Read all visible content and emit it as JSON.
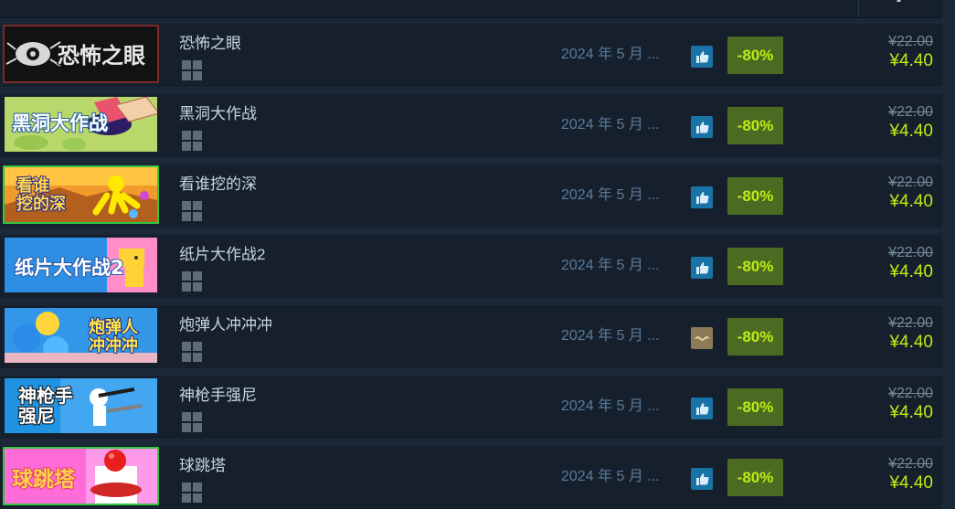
{
  "games": [
    {
      "title": "恐怖之眼",
      "date": "2024 年 5 月 ...",
      "review": "positive",
      "discount": "-80%",
      "original_price": "¥22.00",
      "final_price": "¥4.40",
      "capsule_text": "恐怖之眼",
      "capsule_style": "eyes"
    },
    {
      "title": "黑洞大作战",
      "date": "2024 年 5 月 ...",
      "review": "positive",
      "discount": "-80%",
      "original_price": "¥22.00",
      "final_price": "¥4.40",
      "capsule_text": "黑洞大作战",
      "capsule_style": "hole"
    },
    {
      "title": "看谁挖的深",
      "date": "2024 年 5 月 ...",
      "review": "positive",
      "discount": "-80%",
      "original_price": "¥22.00",
      "final_price": "¥4.40",
      "capsule_text": "看谁\n挖的深",
      "capsule_style": "dig"
    },
    {
      "title": "纸片大作战2",
      "date": "2024 年 5 月 ...",
      "review": "positive",
      "discount": "-80%",
      "original_price": "¥22.00",
      "final_price": "¥4.40",
      "capsule_text": "纸片大作战2",
      "capsule_style": "paper"
    },
    {
      "title": "炮弹人冲冲冲",
      "date": "2024 年 5 月 ...",
      "review": "mixed",
      "discount": "-80%",
      "original_price": "¥22.00",
      "final_price": "¥4.40",
      "capsule_text": "炮弹人\n冲冲冲",
      "capsule_style": "cannon"
    },
    {
      "title": "神枪手强尼",
      "date": "2024 年 5 月 ...",
      "review": "positive",
      "discount": "-80%",
      "original_price": "¥22.00",
      "final_price": "¥4.40",
      "capsule_text": "神枪手\n强尼",
      "capsule_style": "gun"
    },
    {
      "title": "球跳塔",
      "date": "2024 年 5 月 ...",
      "review": "positive",
      "discount": "-80%",
      "original_price": "¥22.00",
      "final_price": "¥4.40",
      "capsule_text": "球跳塔",
      "capsule_style": "tower"
    }
  ],
  "colors": {
    "background": "#1b2838",
    "row_background": "#16202d",
    "title": "#c7d5e0",
    "date": "#5b7a99",
    "discount_bg": "#4c6b22",
    "discount_text": "#beee11",
    "price_original": "#738895",
    "price_final": "#beee11",
    "review_positive": "#1a73a6",
    "review_mixed": "#8b7b58"
  },
  "icons": {
    "platform": "windows-icon",
    "review_positive": "thumbs-up-icon",
    "review_mixed": "mixed-review-icon"
  }
}
